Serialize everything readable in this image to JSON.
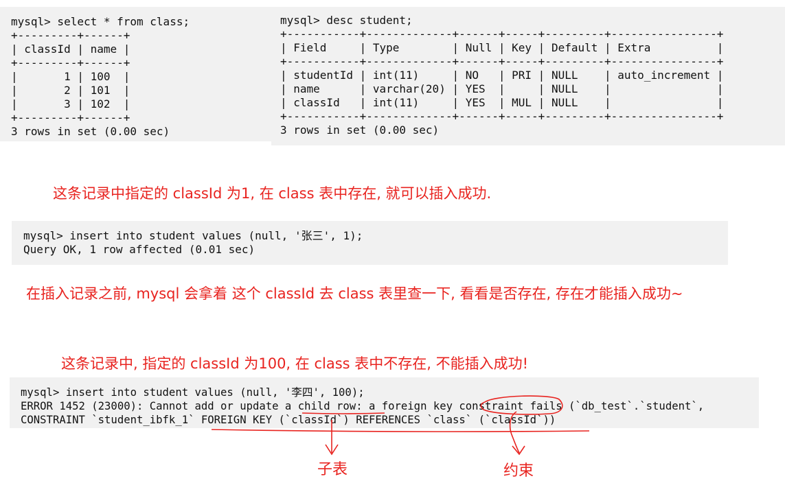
{
  "block_class": {
    "lines": [
      "mysql> select * from class;",
      "+---------+------+",
      "| classId | name |",
      "+---------+------+",
      "|       1 | 100  |",
      "|       2 | 101  |",
      "|       3 | 102  |",
      "+---------+------+",
      "3 rows in set (0.00 sec)"
    ]
  },
  "block_desc": {
    "lines": [
      "mysql> desc student;",
      "+-----------+-------------+------+-----+---------+----------------+",
      "| Field     | Type        | Null | Key | Default | Extra          |",
      "+-----------+-------------+------+-----+---------+----------------+",
      "| studentId | int(11)     | NO   | PRI | NULL    | auto_increment |",
      "| name      | varchar(20) | YES  |     | NULL    |                |",
      "| classId   | int(11)     | YES  | MUL | NULL    |                |",
      "+-----------+-------------+------+-----+---------+----------------+",
      "3 rows in set (0.00 sec)"
    ]
  },
  "note1": "这条记录中指定的 classId 为1, 在 class 表中存在, 就可以插入成功.",
  "block_insert_ok": {
    "lines": [
      "mysql> insert into student values (null, '张三', 1);",
      "Query OK, 1 row affected (0.01 sec)"
    ]
  },
  "note2": "在插入记录之前, mysql 会拿着 这个 classId 去 class 表里查一下, 看看是否存在, 存在才能插入成功~",
  "note3": "这条记录中, 指定的 classId 为100, 在 class 表中不存在, 不能插入成功!",
  "block_insert_err": {
    "lines": [
      "mysql> insert into student values (null, '李四', 100);",
      "ERROR 1452 (23000): Cannot add or update a child row: a foreign key constraint fails (`db_test`.`student`,",
      "CONSTRAINT `student_ibfk_1` FOREIGN KEY (`classId`) REFERENCES `class` (`classId`))"
    ]
  },
  "annotation_child_table": "子表",
  "annotation_constraint": "约束",
  "colors": {
    "annotation": "#e8231f",
    "terminal_bg": "#f1f1f1"
  }
}
